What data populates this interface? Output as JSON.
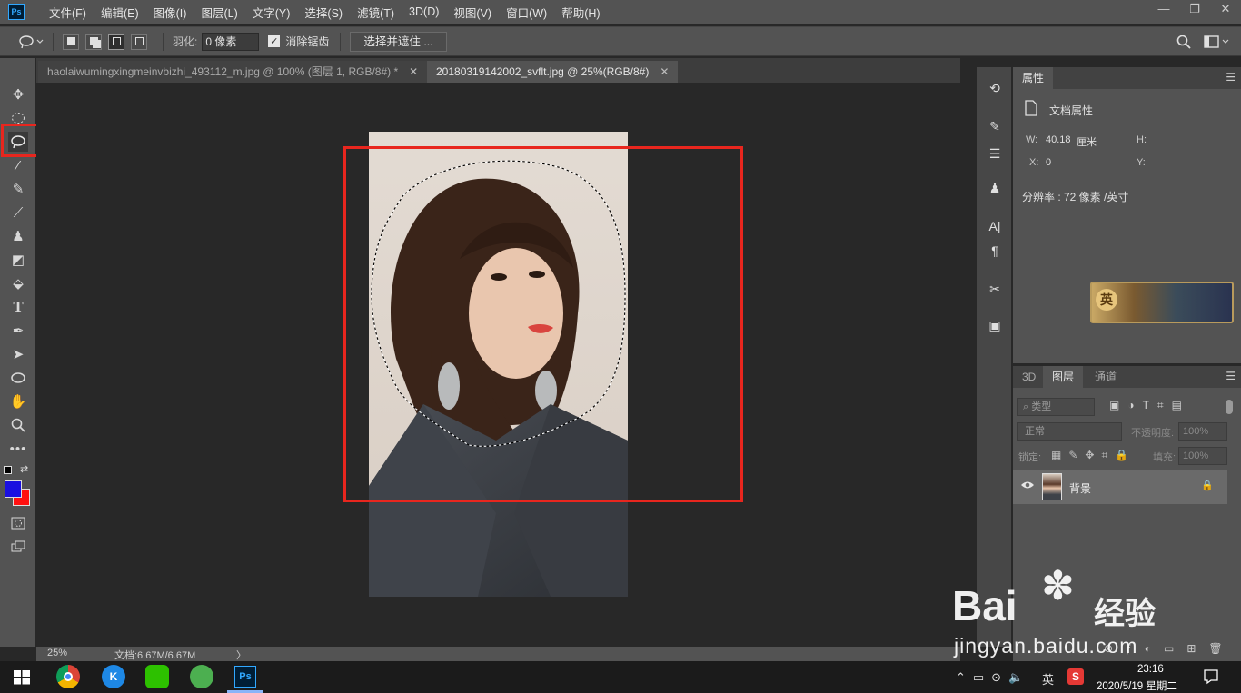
{
  "app": {
    "logo": "Ps"
  },
  "menu": [
    "文件(F)",
    "编辑(E)",
    "图像(I)",
    "图层(L)",
    "文字(Y)",
    "选择(S)",
    "滤镜(T)",
    "3D(D)",
    "视图(V)",
    "窗口(W)",
    "帮助(H)"
  ],
  "window_controls": {
    "minimize": "—",
    "restore": "❐",
    "close": "✕"
  },
  "options": {
    "feather_label": "羽化:",
    "feather_value": "0 像素",
    "antialias_label": "消除锯齿",
    "antialias_checked": "✓",
    "select_mask_label": "选择并遮住 ..."
  },
  "tabs": [
    {
      "title": "haolaiwumingxingmeinvbizhi_493112_m.jpg @ 100% (图层 1, RGB/8#) *",
      "close": "✕"
    },
    {
      "title": "20180319142002_svflt.jpg @ 25%(RGB/8#)",
      "close": "✕"
    }
  ],
  "status": {
    "zoom": "25%",
    "doc": "文档:6.67M/6.67M",
    "arrow": "〉"
  },
  "properties": {
    "tab": "属性",
    "section": "文档属性",
    "w_label": "W:",
    "w_value": "40.18",
    "w_unit": "厘米",
    "h_label": "H:",
    "x_label": "X:",
    "x_value": "0",
    "y_label": "Y:",
    "resolution": "分辨率 : 72 像素 /英寸"
  },
  "layers_panel": {
    "tabs": [
      "3D",
      "图层",
      "通道"
    ],
    "filter_label": "类型",
    "blend_mode": "正常",
    "opacity_label": "不透明度:",
    "opacity_value": "100%",
    "lock_label": "锁定:",
    "fill_label": "填充:",
    "fill_value": "100%",
    "layer_name": "背景"
  },
  "watermark": {
    "brand": "Bai",
    "brand2": "经验",
    "url": "jingyan.baidu.com"
  },
  "taskbar": {
    "ime": "英",
    "time": "23:16",
    "date": "2020/5/19 星期二"
  },
  "colors": {
    "foreground": "#1a10e0",
    "background": "#ff1010",
    "highlight": "#e8261e"
  }
}
